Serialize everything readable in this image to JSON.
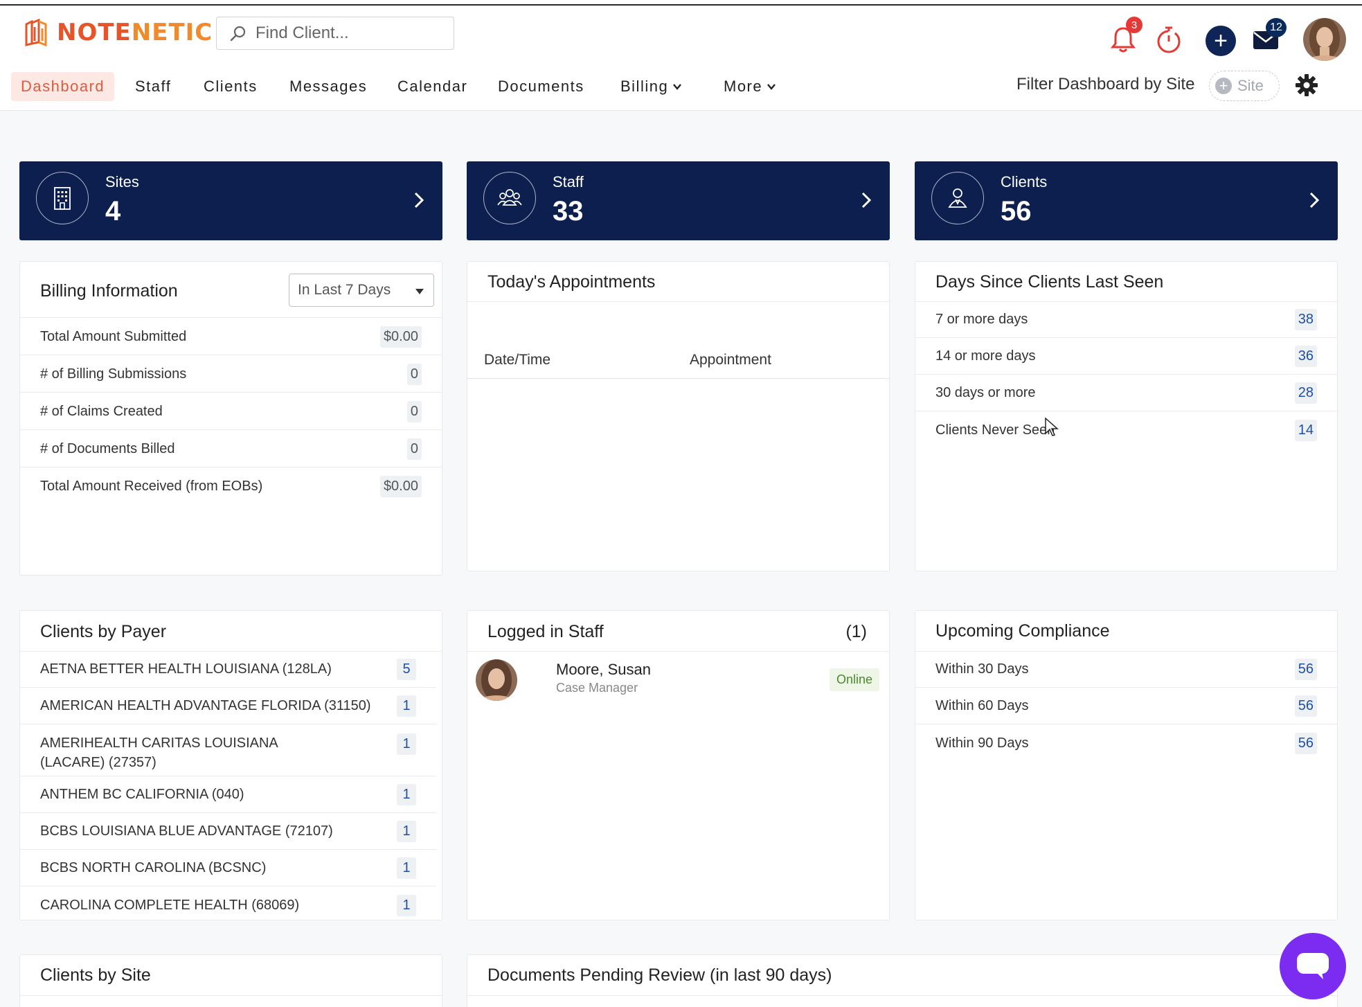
{
  "app": {
    "logo_text_a": "NOTE",
    "logo_text_b": "NETIC"
  },
  "search": {
    "placeholder": "Find Client..."
  },
  "header": {
    "notifications_count": "3",
    "messages_count": "12"
  },
  "nav": {
    "items": [
      {
        "label": "Dashboard",
        "active": true
      },
      {
        "label": "Staff"
      },
      {
        "label": "Clients"
      },
      {
        "label": "Messages"
      },
      {
        "label": "Calendar"
      },
      {
        "label": "Documents"
      },
      {
        "label": "Billing"
      },
      {
        "label": "More"
      }
    ],
    "filter_label": "Filter Dashboard by Site",
    "site_pill": "Site"
  },
  "stats": [
    {
      "label": "Sites",
      "value": "4",
      "icon": "building-icon"
    },
    {
      "label": "Staff",
      "value": "33",
      "icon": "group-icon"
    },
    {
      "label": "Clients",
      "value": "56",
      "icon": "person-icon"
    }
  ],
  "billing": {
    "title": "Billing Information",
    "range": "In Last 7 Days",
    "rows": [
      {
        "label": "Total Amount Submitted",
        "value": "$0.00"
      },
      {
        "label": "# of Billing Submissions",
        "value": "0"
      },
      {
        "label": "# of Claims Created",
        "value": "0"
      },
      {
        "label": "# of Documents Billed",
        "value": "0"
      },
      {
        "label": "Total Amount Received (from EOBs)",
        "value": "$0.00"
      }
    ]
  },
  "appointments": {
    "title": "Today's Appointments",
    "col_datetime": "Date/Time",
    "col_appointment": "Appointment"
  },
  "last_seen": {
    "title": "Days Since Clients Last Seen",
    "rows": [
      {
        "label": "7 or more days",
        "value": "38"
      },
      {
        "label": "14 or more days",
        "value": "36"
      },
      {
        "label": "30 days or more",
        "value": "28"
      },
      {
        "label": "Clients Never Seen",
        "value": "14"
      }
    ]
  },
  "payer": {
    "title": "Clients by Payer",
    "rows": [
      {
        "label": "AETNA BETTER HEALTH LOUISIANA (128LA)",
        "value": "5"
      },
      {
        "label": "AMERICAN HEALTH ADVANTAGE FLORIDA (31150)",
        "value": "1"
      },
      {
        "label": "AMERIHEALTH CARITAS LOUISIANA (LACARE) (27357)",
        "value": "1"
      },
      {
        "label": "ANTHEM BC CALIFORNIA (040)",
        "value": "1"
      },
      {
        "label": "BCBS LOUISIANA BLUE ADVANTAGE (72107)",
        "value": "1"
      },
      {
        "label": "BCBS NORTH CAROLINA (BCSNC)",
        "value": "1"
      },
      {
        "label": "CAROLINA COMPLETE HEALTH (68069)",
        "value": "1"
      }
    ]
  },
  "logged_in": {
    "title": "Logged in Staff",
    "count": "(1)",
    "staff": {
      "name": "Moore, Susan",
      "role": "Case Manager",
      "status": "Online"
    }
  },
  "compliance": {
    "title": "Upcoming Compliance",
    "rows": [
      {
        "label": "Within 30 Days",
        "value": "56"
      },
      {
        "label": "Within 60 Days",
        "value": "56"
      },
      {
        "label": "Within 90 Days",
        "value": "56"
      }
    ]
  },
  "clients_by_site": {
    "title": "Clients by Site"
  },
  "pending_docs": {
    "title": "Documents Pending Review (in last 90 days)"
  },
  "colors": {
    "navy": "#0d1f4f",
    "accent": "#e05a3c",
    "chat": "#7b2cf0",
    "link": "#1e4fa8"
  }
}
